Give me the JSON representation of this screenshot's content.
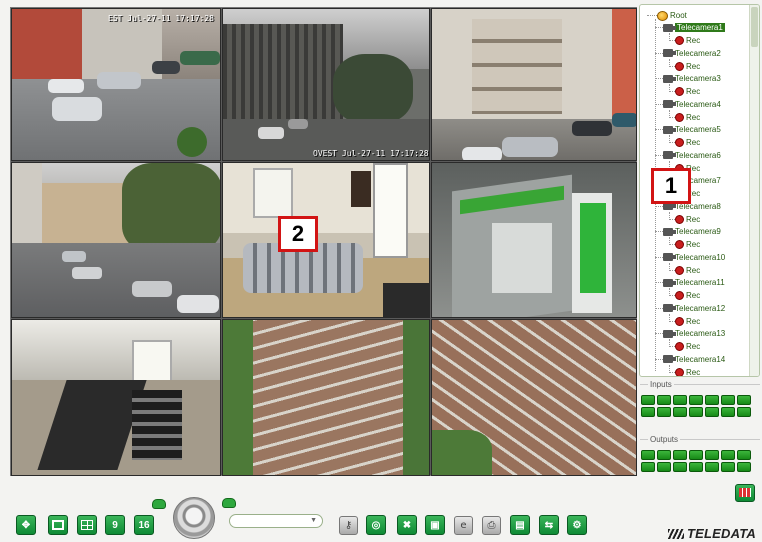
{
  "cameras": [
    {
      "id": "cam1",
      "osd": "EST Jul-27-11 17:17:28",
      "selected": true
    },
    {
      "id": "cam2",
      "osd": "OVEST Jul-27-11 17:17:28",
      "selected": false
    },
    {
      "id": "cam3",
      "osd": "",
      "selected": false
    },
    {
      "id": "cam4",
      "osd": "",
      "selected": false
    },
    {
      "id": "cam5",
      "osd": "",
      "selected": false
    },
    {
      "id": "cam6",
      "osd": "",
      "selected": false
    },
    {
      "id": "cam7",
      "osd": "",
      "selected": false
    },
    {
      "id": "cam8",
      "osd": "",
      "selected": false
    },
    {
      "id": "cam9",
      "osd": "",
      "selected": false
    }
  ],
  "callouts": {
    "one": "1",
    "two": "2"
  },
  "tree": {
    "root": "Root",
    "rec_label": "Rec",
    "cameras": [
      "Telecamera1",
      "Telecamera2",
      "Telecamera3",
      "Telecamera4",
      "Telecamera5",
      "Telecamera6",
      "Telecamera7",
      "Telecamera8",
      "Telecamera9",
      "Telecamera10",
      "Telecamera11",
      "Telecamera12",
      "Telecamera13",
      "Telecamera14"
    ],
    "selected": "Telecamera1"
  },
  "inputs": {
    "title": "Inputs",
    "count": 14
  },
  "outputs": {
    "title": "Outputs",
    "count": 14
  },
  "toolbar": {
    "layout_9": "9",
    "layout_16": "16",
    "camera_select_value": "",
    "icons": [
      "fullscreen-icon",
      "single-view-icon",
      "quad-view-icon",
      "nine-view-icon",
      "sixteen-view-icon",
      "ptz-joystick-icon",
      "key-icon",
      "target-icon",
      "tools-icon",
      "snapshot-icon",
      "browser-icon",
      "print-icon",
      "playback-icon",
      "switch-icon",
      "settings-icon"
    ]
  },
  "logo": "TELEDATA",
  "colors": {
    "accent": "#178a17",
    "callout_border": "#d21414",
    "selection": "#f4e300"
  }
}
